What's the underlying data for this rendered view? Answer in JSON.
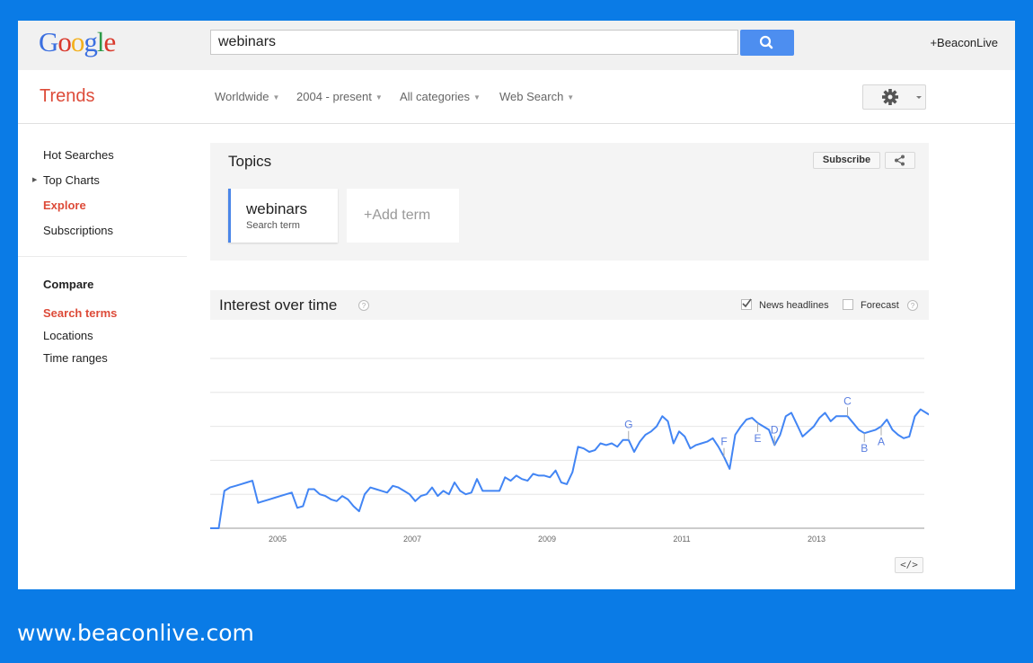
{
  "header": {
    "logo": [
      "G",
      "o",
      "o",
      "g",
      "l",
      "e"
    ],
    "search_value": "webinars",
    "user_label": "+BeaconLive"
  },
  "trendsbar": {
    "title": "Trends",
    "filters": [
      "Worldwide",
      "2004 - present",
      "All categories",
      "Web Search"
    ]
  },
  "sidebar": {
    "items": [
      {
        "label": "Hot Searches"
      },
      {
        "label": "Top Charts"
      },
      {
        "label": "Explore"
      },
      {
        "label": "Subscriptions"
      }
    ],
    "compare_header": "Compare",
    "compare_items": [
      {
        "label": "Search terms"
      },
      {
        "label": "Locations"
      },
      {
        "label": "Time ranges"
      }
    ]
  },
  "topics": {
    "title": "Topics",
    "subscribe_label": "Subscribe",
    "term": "webinars",
    "term_type": "Search term",
    "add_term_label": "+Add term"
  },
  "interest": {
    "title": "Interest over time",
    "news_headlines_label": "News headlines",
    "news_headlines_checked": true,
    "forecast_label": "Forecast",
    "forecast_checked": false,
    "embed_label": "</>"
  },
  "chart_data": {
    "type": "line",
    "title": "Interest over time",
    "series": [
      {
        "name": "webinars",
        "color": "#4285f4"
      }
    ],
    "x_start": "2004-01",
    "x_step": "month",
    "xticks": [
      "2005",
      "2007",
      "2009",
      "2011",
      "2013"
    ],
    "ylim": [
      0,
      100
    ],
    "grid": true,
    "values": [
      0,
      0,
      0,
      22,
      24,
      25,
      26,
      27,
      28,
      15,
      16,
      17,
      18,
      19,
      20,
      21,
      12,
      13,
      23,
      23,
      20,
      19,
      17,
      16,
      19,
      17,
      13,
      10,
      20,
      24,
      23,
      22,
      21,
      25,
      24,
      22,
      20,
      16,
      19,
      20,
      24,
      19,
      22,
      20,
      27,
      22,
      20,
      21,
      29,
      22,
      22,
      22,
      22,
      30,
      28,
      31,
      29,
      28,
      32,
      31,
      31,
      30,
      34,
      27,
      26,
      33,
      48,
      47,
      45,
      46,
      50,
      49,
      50,
      48,
      52,
      52,
      45,
      51,
      55,
      57,
      60,
      66,
      63,
      50,
      57,
      54,
      47,
      49,
      50,
      51,
      53,
      48,
      42,
      35,
      55,
      60,
      64,
      65,
      62,
      60,
      58,
      49,
      55,
      66,
      68,
      61,
      54,
      57,
      60,
      65,
      68,
      63,
      66,
      66,
      66,
      62,
      58,
      56,
      57,
      58,
      60,
      64,
      58,
      55,
      53,
      54,
      66,
      70,
      68,
      66,
      65,
      63,
      62,
      62,
      65,
      69,
      66,
      65,
      68,
      70,
      64,
      58,
      67,
      72,
      71,
      67,
      69,
      65,
      64,
      66,
      65,
      62,
      60
    ],
    "annotations": [
      {
        "label": "G",
        "x": "2010-04"
      },
      {
        "label": "F",
        "x": "2011-09"
      },
      {
        "label": "E",
        "x": "2012-03"
      },
      {
        "label": "D",
        "x": "2012-06"
      },
      {
        "label": "C",
        "x": "2013-07"
      },
      {
        "label": "B",
        "x": "2013-10"
      },
      {
        "label": "A",
        "x": "2014-01"
      }
    ]
  },
  "footer": {
    "url": "www.beaconlive.com"
  },
  "colors": {
    "frame": "#0a7be6",
    "accent_red": "#dd4b39",
    "line": "#4285f4",
    "search_btn": "#4d8ef0"
  }
}
